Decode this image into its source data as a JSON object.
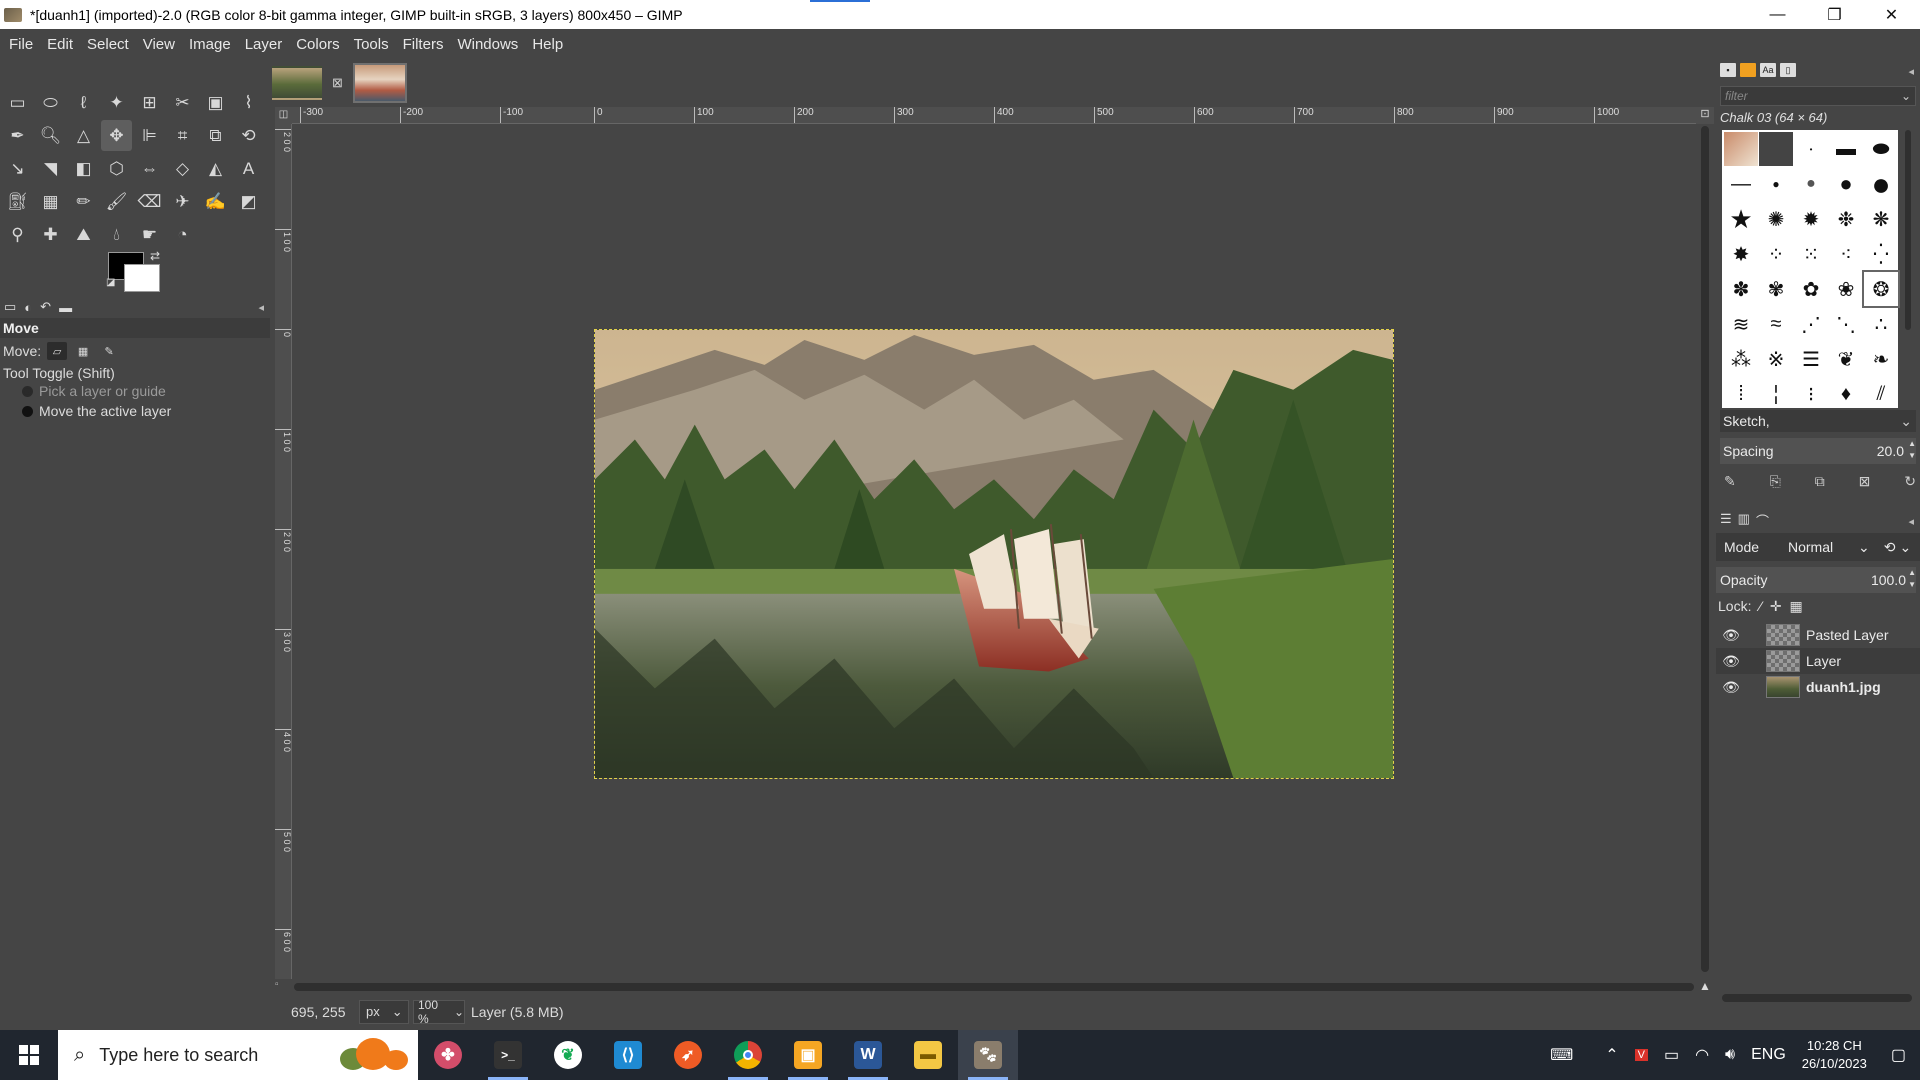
{
  "window": {
    "title": "*[duanh1] (imported)-2.0 (RGB color 8-bit gamma integer, GIMP built-in sRGB, 3 layers) 800x450 – GIMP",
    "minimize": "—",
    "restore": "❐",
    "close": "✕"
  },
  "menu": [
    "File",
    "Edit",
    "Select",
    "View",
    "Image",
    "Layer",
    "Colors",
    "Tools",
    "Filters",
    "Windows",
    "Help"
  ],
  "tool_options": {
    "title": "Move",
    "move_label": "Move:",
    "toggle_label": "Tool Toggle  (Shift)",
    "option_1": "Pick a layer or guide",
    "option_2": "Move the active layer"
  },
  "ruler": {
    "h_ticks": [
      "-300",
      "-200",
      "-100",
      "0",
      "100",
      "200",
      "300",
      "400",
      "500",
      "600",
      "700",
      "800",
      "900",
      "1000"
    ],
    "v_ticks": [
      "2 0 0",
      "1 0 0",
      "0",
      "1 0 0",
      "2 0 0",
      "3 0 0",
      "4 0 0",
      "5 0 0",
      "6 0 0"
    ]
  },
  "status": {
    "coords": "695, 255",
    "unit": "px",
    "zoom": "100 %",
    "layer_info": "Layer (5.8 MB)"
  },
  "brushes": {
    "filter_placeholder": "filter",
    "current_brush": "Chalk 03 (64 × 64)",
    "preset": "Sketch,",
    "spacing_label": "Spacing",
    "spacing_value": "20.0"
  },
  "layers": {
    "mode_label": "Mode",
    "mode_value": "Normal",
    "opacity_label": "Opacity",
    "opacity_value": "100.0",
    "lock_label": "Lock:",
    "items": [
      {
        "name": "Pasted Layer",
        "visible": true
      },
      {
        "name": "Layer",
        "visible": true
      },
      {
        "name": "duanh1.jpg",
        "visible": true
      }
    ]
  },
  "taskbar": {
    "search_placeholder": "Type here to search",
    "language": "ENG",
    "time": "10:28 CH",
    "date": "26/10/2023"
  },
  "colors": {
    "foreground": "#000000",
    "background": "#ffffff",
    "selection_outline": "#e2d24a"
  }
}
